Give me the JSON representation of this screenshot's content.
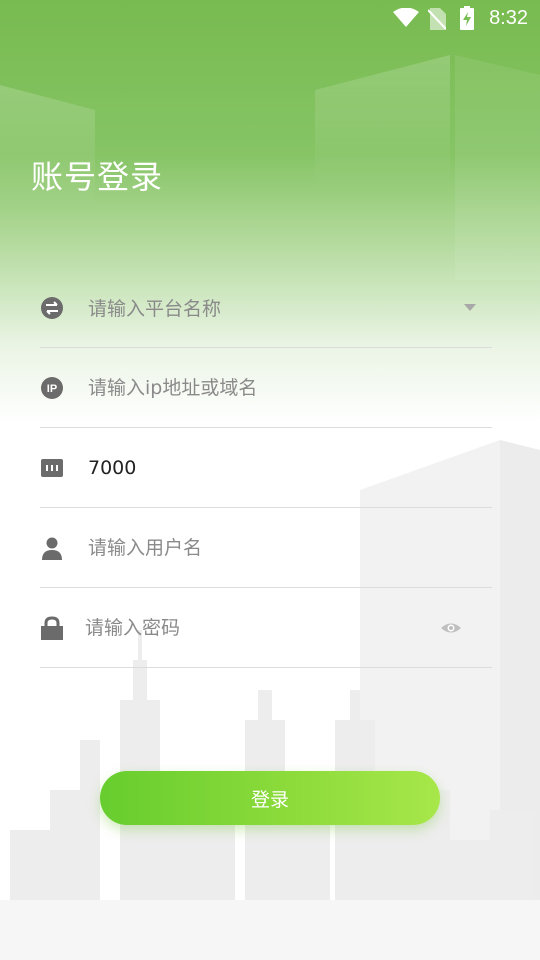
{
  "status_bar": {
    "time": "8:32",
    "icons": [
      "wifi-icon",
      "no-sim-icon",
      "battery-charging-icon"
    ]
  },
  "header": {
    "title": "账号登录"
  },
  "form": {
    "platform": {
      "placeholder": "请输入平台名称",
      "icon": "swap-icon",
      "dropdown_icon": "dropdown-arrow-icon"
    },
    "address": {
      "placeholder": "请输入ip地址或域名",
      "icon": "ip-icon"
    },
    "port": {
      "value": "7000",
      "icon": "ethernet-port-icon"
    },
    "username": {
      "placeholder": "请输入用户名",
      "icon": "user-icon"
    },
    "password": {
      "placeholder": "请输入密码",
      "icon": "lock-icon",
      "toggle_icon": "eye-icon"
    }
  },
  "login_button": {
    "label": "登录"
  },
  "colors": {
    "header_green": "#79bd55",
    "button_start": "#67cd2e",
    "button_end": "#a7e74a",
    "icon_gray": "#6b6b6b"
  }
}
